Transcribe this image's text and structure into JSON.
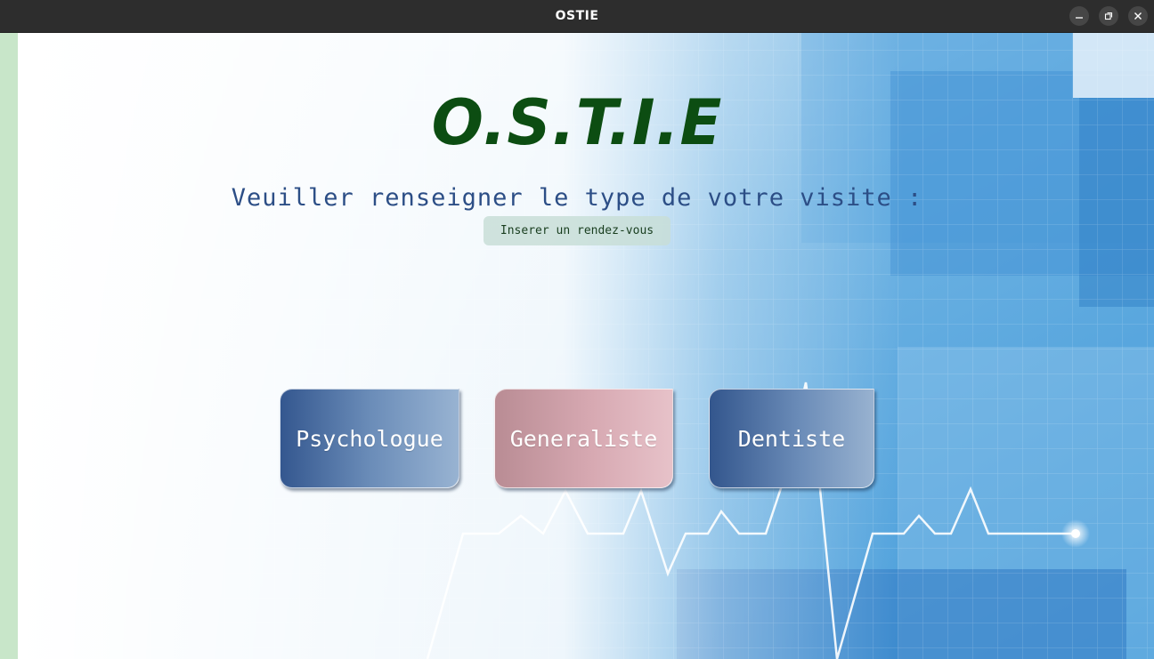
{
  "window": {
    "title": "OSTIE",
    "controls": [
      "minimize-icon",
      "restore-icon",
      "close-icon"
    ]
  },
  "main": {
    "app_title": "O.S.T.I.E",
    "prompt": "Veuiller renseigner le type de votre visite :",
    "appointment_button": "Inserer un rendez-vous",
    "visit_types": [
      "Psychologue",
      "Generaliste",
      "Dentiste"
    ]
  },
  "colors": {
    "title_green": "#0c4d12",
    "prompt_blue": "#2c4e86",
    "left_strip": "#c8e6c9",
    "psychologue_button": "#34578f",
    "generaliste_button": "#c49aa2",
    "dentiste_button": "#33568d"
  }
}
